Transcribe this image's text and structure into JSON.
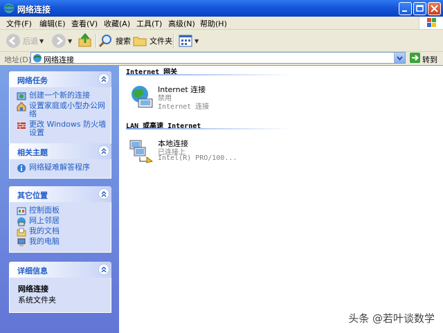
{
  "window": {
    "title": "网络连接"
  },
  "menu": [
    "文件(F)",
    "编辑(E)",
    "查看(V)",
    "收藏(A)",
    "工具(T)",
    "高级(N)",
    "帮助(H)"
  ],
  "toolbar": {
    "back_label": "后退",
    "search_label": "搜索",
    "folders_label": "文件夹"
  },
  "address": {
    "label": "地址(D)",
    "value": "网络连接",
    "go_label": "转到"
  },
  "panels": {
    "network_tasks": {
      "title": "网络任务",
      "items": [
        "创建一个新的连接",
        "设置家庭或小型办公网络",
        "更改 Windows 防火墙设置"
      ]
    },
    "related": {
      "title": "相关主题",
      "items": [
        "网络疑难解答程序"
      ]
    },
    "places": {
      "title": "其它位置",
      "items": [
        "控制面板",
        "网上邻居",
        "我的文档",
        "我的电脑"
      ]
    },
    "details": {
      "title": "详细信息",
      "name": "网络连接",
      "type": "系统文件夹"
    }
  },
  "groups": {
    "gateway": {
      "title": "Internet 网关",
      "item": {
        "name": "Internet 连接",
        "status": "禁用",
        "device": "Internet 连接"
      }
    },
    "lan": {
      "title": "LAN 或高速 Internet",
      "item": {
        "name": "本地连接",
        "status": "已连接上",
        "device": "Intel(R) PRO/100..."
      }
    }
  },
  "watermark": "头条 @若叶谈数学"
}
